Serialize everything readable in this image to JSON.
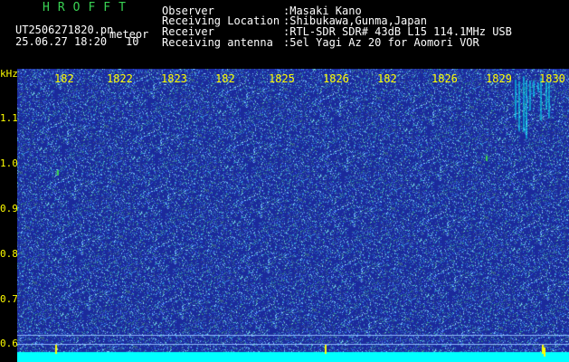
{
  "header": {
    "title": "HROFFT",
    "filename": "UT2506271820.pn",
    "type_label": "meteor",
    "datetime": "25.06.27 18:20",
    "count": "10"
  },
  "meta": [
    {
      "key": "Observer",
      "value": ":Masaki Kano"
    },
    {
      "key": "Receiving Location",
      "value": ":Shibukawa,Gunma,Japan"
    },
    {
      "key": "Receiver",
      "value": ":RTL-SDR SDR# 43dB L15 114.1MHz USB"
    },
    {
      "key": "Receiving antenna",
      "value": ":5el Yagi Az 20 for Aomori VOR"
    }
  ],
  "axis": {
    "y_unit": "kHz",
    "y_ticks": [
      "1.1",
      "1.0",
      "0.9",
      "0.8",
      "0.7",
      "0.6"
    ],
    "x_ticks": [
      "182",
      "1822",
      "1823",
      "182",
      "1825",
      "1826",
      "182",
      "1826",
      "1829",
      "1830"
    ]
  },
  "colors": {
    "background": "#000000",
    "spectrum_base": "#1b2a9c",
    "noise": "#3a7bd5",
    "signal": "#00ffff",
    "tick_text": "#ffff00",
    "title": "#39d353"
  }
}
